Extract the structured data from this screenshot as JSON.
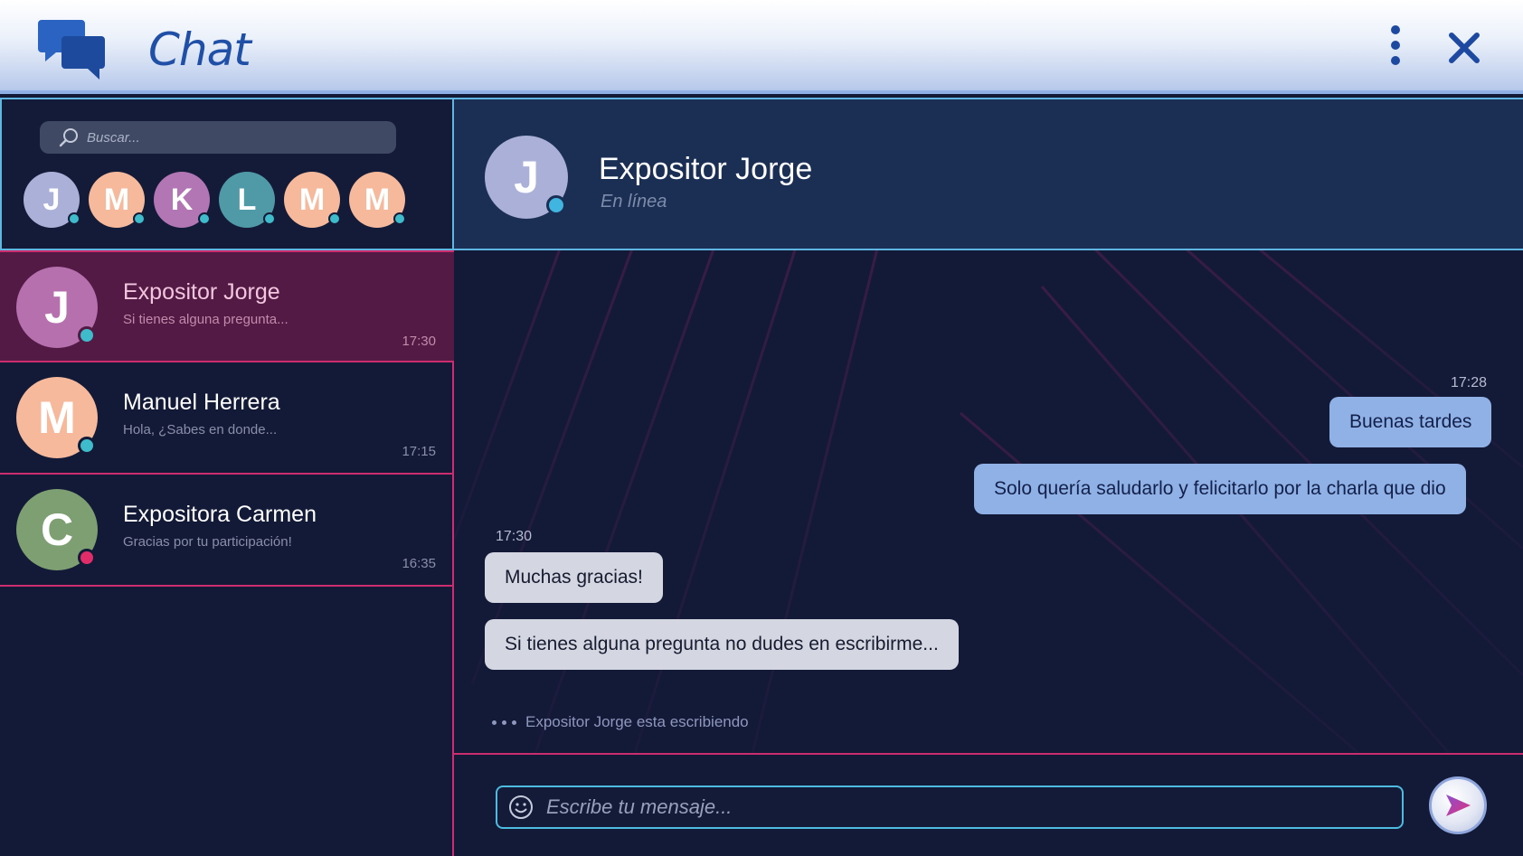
{
  "app": {
    "title": "Chat"
  },
  "icons": {
    "logo": "chat-bubbles-icon",
    "menu": "more-vertical-icon",
    "close": "close-icon",
    "search": "search-icon",
    "emoji": "smiley-icon",
    "send": "send-icon"
  },
  "colors": {
    "online": "#3fbccc",
    "busy": "#e02d6a",
    "accent": "#cc2d6e",
    "highlight_border": "#5fb6e1"
  },
  "search": {
    "placeholder": "Buscar..."
  },
  "quick_contacts": [
    {
      "initial": "J",
      "color": "#aab0d8",
      "status": "online"
    },
    {
      "initial": "M",
      "color": "#f6b99c",
      "status": "online"
    },
    {
      "initial": "K",
      "color": "#b276b5",
      "status": "online"
    },
    {
      "initial": "L",
      "color": "#4f9aa6",
      "status": "online"
    },
    {
      "initial": "M",
      "color": "#f6b99c",
      "status": "online"
    },
    {
      "initial": "M",
      "color": "#f6b99c",
      "status": "online"
    }
  ],
  "conversations": [
    {
      "initial": "J",
      "name": "Expositor Jorge",
      "preview": "Si tienes alguna pregunta...",
      "time": "17:30",
      "color": "#b570ad",
      "status": "online",
      "active": true
    },
    {
      "initial": "M",
      "name": "Manuel Herrera",
      "preview": "Hola, ¿Sabes en donde...",
      "time": "17:15",
      "color": "#f6b99c",
      "status": "online",
      "active": false
    },
    {
      "initial": "C",
      "name": "Expositora Carmen",
      "preview": "Gracias por tu participación!",
      "time": "16:35",
      "color": "#7e9f72",
      "status": "busy",
      "active": false
    }
  ],
  "chat": {
    "contact_initial": "J",
    "contact_name": "Expositor Jorge",
    "contact_status": "En línea",
    "outgoing_time": "17:28",
    "outgoing": [
      "Buenas tardes",
      "Solo quería saludarlo y felicitarlo por la charla que dio"
    ],
    "incoming_time": "17:30",
    "incoming": [
      "Muchas gracias!",
      "Si tienes alguna pregunta no dudes en escribirme..."
    ],
    "typing": "Expositor Jorge esta escribiendo"
  },
  "composer": {
    "placeholder": "Escribe tu mensaje..."
  }
}
